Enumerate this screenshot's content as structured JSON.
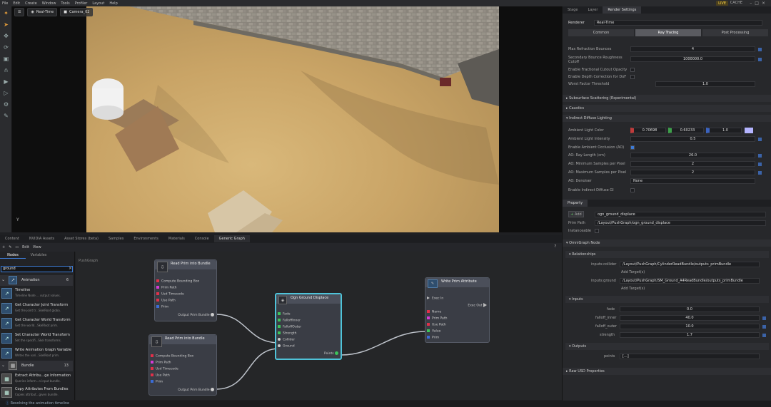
{
  "menu": [
    "File",
    "Edit",
    "Create",
    "Window",
    "Tools",
    "Profiler",
    "Layout",
    "Help"
  ],
  "live_label": "LIVE",
  "cache_label": "CACHE",
  "viewport": {
    "render_mode": "Real-Time",
    "camera": "Camera_02",
    "axis_label": "Y"
  },
  "right_panel": {
    "tabs": [
      "Stage",
      "Layer",
      "Render Settings"
    ],
    "renderer_label": "Renderer",
    "renderer_value": "Real-Time",
    "subtabs": [
      "Common",
      "Ray Tracing",
      "Post Processing"
    ],
    "rows_top": [
      {
        "label": "Max Refraction Bounces",
        "value": "4"
      },
      {
        "label": "Secondary Bounce Roughness Cutoff",
        "value": "1000000.0"
      },
      {
        "label": "Enable Fractional Cutout Opacity",
        "value": ""
      },
      {
        "label": "Enable Depth Correction for DoF",
        "value": ""
      },
      {
        "label": "Worst Factor Threshold",
        "value": "1.0"
      }
    ],
    "sections": [
      "Subsurface Scattering (Experimental)",
      "Caustics",
      "Indirect Diffuse Lighting"
    ],
    "ambient_color_label": "Ambient Light Color",
    "ambient_color": {
      "r": "0.70698",
      "g": "0.60233",
      "b": "1.0"
    },
    "rows_idl": [
      {
        "label": "Ambient Light Intensity",
        "value": "0.5"
      },
      {
        "label": "Enable Ambient Occlusion (AO)",
        "value": ""
      },
      {
        "label": "AO: Ray Length (cm)",
        "value": "26.0"
      },
      {
        "label": "AO: Minimum Samples per Pixel",
        "value": "2"
      },
      {
        "label": "AO: Maximum Samples per Pixel",
        "value": "2"
      },
      {
        "label": "AO: Denoiser",
        "value": "None"
      },
      {
        "label": "Enable Indirect Diffuse GI",
        "value": ""
      }
    ],
    "property_tab": "Property",
    "add_label": "Add",
    "add_value": "ogn_ground_displace",
    "prim_path_label": "Prim Path",
    "prim_path_value": "/Layout/PushGraph/ogn_ground_displace",
    "instanceable_label": "Instanceable",
    "omnigraph_node": "OmniGraph Node",
    "relationships": "Relationships",
    "rel_rows": [
      {
        "label": "inputs:collider",
        "value": "/Layout/PushGraph/CylinderReadBundle/outputs_primBundle",
        "add": "Add Target(s)"
      },
      {
        "label": "inputs:ground",
        "value": "/Layout/PushGraph/SM_Ground_A4ReadBundle/outputs_primBundle",
        "add": "Add Target(s)"
      }
    ],
    "inputs_section": "Inputs",
    "input_rows": [
      {
        "label": "fade",
        "value": "0.0"
      },
      {
        "label": "falloff_inner",
        "value": "40.0"
      },
      {
        "label": "falloff_outer",
        "value": "10.0"
      },
      {
        "label": "strength",
        "value": "1.7"
      }
    ],
    "outputs_section": "Outputs",
    "output_rows": [
      {
        "label": "points",
        "value": "[...]"
      }
    ],
    "raw_usd": "Raw USD Properties"
  },
  "bottom": {
    "tabs": [
      "Content",
      "NVIDIA Assets",
      "Asset Stores (beta)",
      "Samples",
      "Environments",
      "Materials",
      "Console",
      "Generic Graph"
    ],
    "graph_menu": [
      "Edit",
      "View"
    ],
    "help": "?",
    "lib_tabs": [
      "Nodes",
      "Variables"
    ],
    "search_value": "ground",
    "categories": [
      {
        "name": "Animation",
        "count": "6"
      },
      {
        "name": "Bundle",
        "count": "13"
      }
    ],
    "anim_items": [
      {
        "title": "Timeline",
        "desc": "Timeline Node ... output values."
      },
      {
        "title": "Get Character Joint Transform",
        "desc": "Get the joint tr...SkelRoot globa."
      },
      {
        "title": "Get Character World Transform",
        "desc": "Get the world...SkelRoot prim."
      },
      {
        "title": "Set Character World Transform",
        "desc": "Set the specifi...Skel transforms."
      },
      {
        "title": "Write Animation Graph Variable",
        "desc": "Writes the vari...SkelRoot prim."
      }
    ],
    "bundle_items": [
      {
        "title": "Extract Attribu...ge Information",
        "desc": "Queries inform...n input bundle."
      },
      {
        "title": "Copy Attributes From Bundles",
        "desc": "Copies attribut...given bundle."
      }
    ],
    "breadcrumb": "PushGraph",
    "nodes": {
      "read1": {
        "title": "Read Prim into Bundle",
        "ports": [
          "Compute Bounding Box",
          "Prim Path",
          "Usd Timecode",
          "Use Path",
          "Prim"
        ],
        "out": "Output Prim Bundle"
      },
      "read2": {
        "title": "Read Prim into Bundle",
        "ports": [
          "Compute Bounding Box",
          "Prim Path",
          "Usd Timecode",
          "Use Path",
          "Prim"
        ],
        "out": "Output Prim Bundle"
      },
      "ogn": {
        "title": "Ogn Ground Displace",
        "ports": [
          "Fade",
          "FalloffInner",
          "FalloffOuter",
          "Strength",
          "Collider",
          "Ground"
        ],
        "out": "Points"
      },
      "write": {
        "title": "Write Prim Attribute",
        "ports": [
          "Exec In",
          "Name",
          "Prim Path",
          "Use Path",
          "Value",
          "Prim"
        ],
        "out": "Exec Out"
      }
    },
    "status": "Resolving the animation timeline"
  },
  "colors": {
    "accent": "#3d7bd6",
    "selected_node": "#4fc3d9"
  }
}
